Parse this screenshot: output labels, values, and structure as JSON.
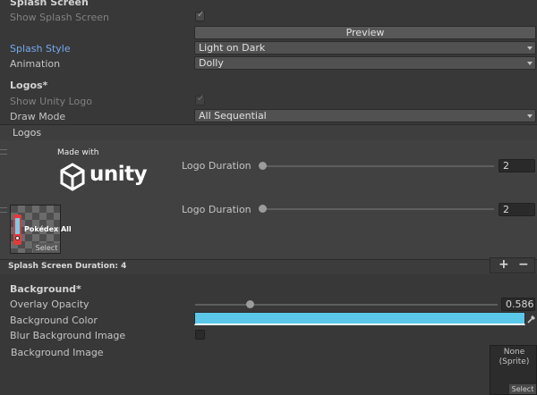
{
  "splash": {
    "header": "Splash Screen",
    "show_splash_label": "Show Splash Screen",
    "preview_label": "Preview",
    "style_label": "Splash Style",
    "style_value": "Light on Dark",
    "animation_label": "Animation",
    "animation_value": "Dolly"
  },
  "logos": {
    "header": "Logos*",
    "show_unity_logo_label": "Show Unity Logo",
    "draw_mode_label": "Draw Mode",
    "draw_mode_value": "All Sequential",
    "list_header": "Logos",
    "items": [
      {
        "made_with": "Made with",
        "brand": "unity",
        "duration_label": "Logo Duration",
        "duration_value": "2",
        "slider_fraction": 0.0
      },
      {
        "image_text": "Pokédex All",
        "select_label": "Select",
        "duration_label": "Logo Duration",
        "duration_value": "2",
        "slider_fraction": 0.0
      }
    ],
    "total_duration": "Splash Screen Duration: 4",
    "add_symbol": "+",
    "remove_symbol": "−"
  },
  "background": {
    "header": "Background*",
    "overlay_opacity_label": "Overlay Opacity",
    "overlay_opacity_value": "0.586",
    "overlay_opacity_fraction": 0.18,
    "color_label": "Background Color",
    "color_value": "#5bc8ea",
    "blur_label": "Blur Background Image",
    "image_label": "Background Image",
    "image_none": "None",
    "image_type": "(Sprite)",
    "image_select": "Select"
  },
  "icons": {
    "check": "check-icon",
    "dropdown": "chevron-down-icon",
    "drag": "drag-handle-icon",
    "eyedropper": "eyedropper-icon"
  }
}
